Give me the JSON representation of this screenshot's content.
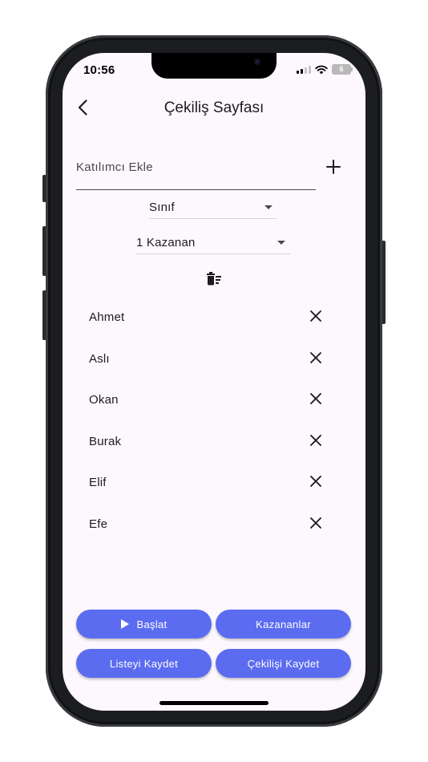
{
  "status_bar": {
    "time": "10:56",
    "battery": "6"
  },
  "appbar": {
    "title": "Çekiliş Sayfası",
    "back_icon": "chevron-left-icon"
  },
  "add_participant": {
    "placeholder": "Katılımcı Ekle",
    "value": "",
    "icon": "plus-icon"
  },
  "dropdowns": {
    "class_selected": "Sınıf",
    "winner_count_selected": "1 Kazanan"
  },
  "clear_list_icon": "delete-sweep-icon",
  "participants": [
    {
      "name": "Ahmet"
    },
    {
      "name": "Aslı"
    },
    {
      "name": "Okan"
    },
    {
      "name": "Burak"
    },
    {
      "name": "Elif"
    },
    {
      "name": "Efe"
    }
  ],
  "buttons": {
    "start": "Başlat",
    "winners": "Kazananlar",
    "save_list": "Listeyi Kaydet",
    "save_draw": "Çekilişi Kaydet"
  },
  "colors": {
    "primary": "#5b6cf0",
    "background": "#fdf8fd",
    "text": "#1d1b20"
  }
}
